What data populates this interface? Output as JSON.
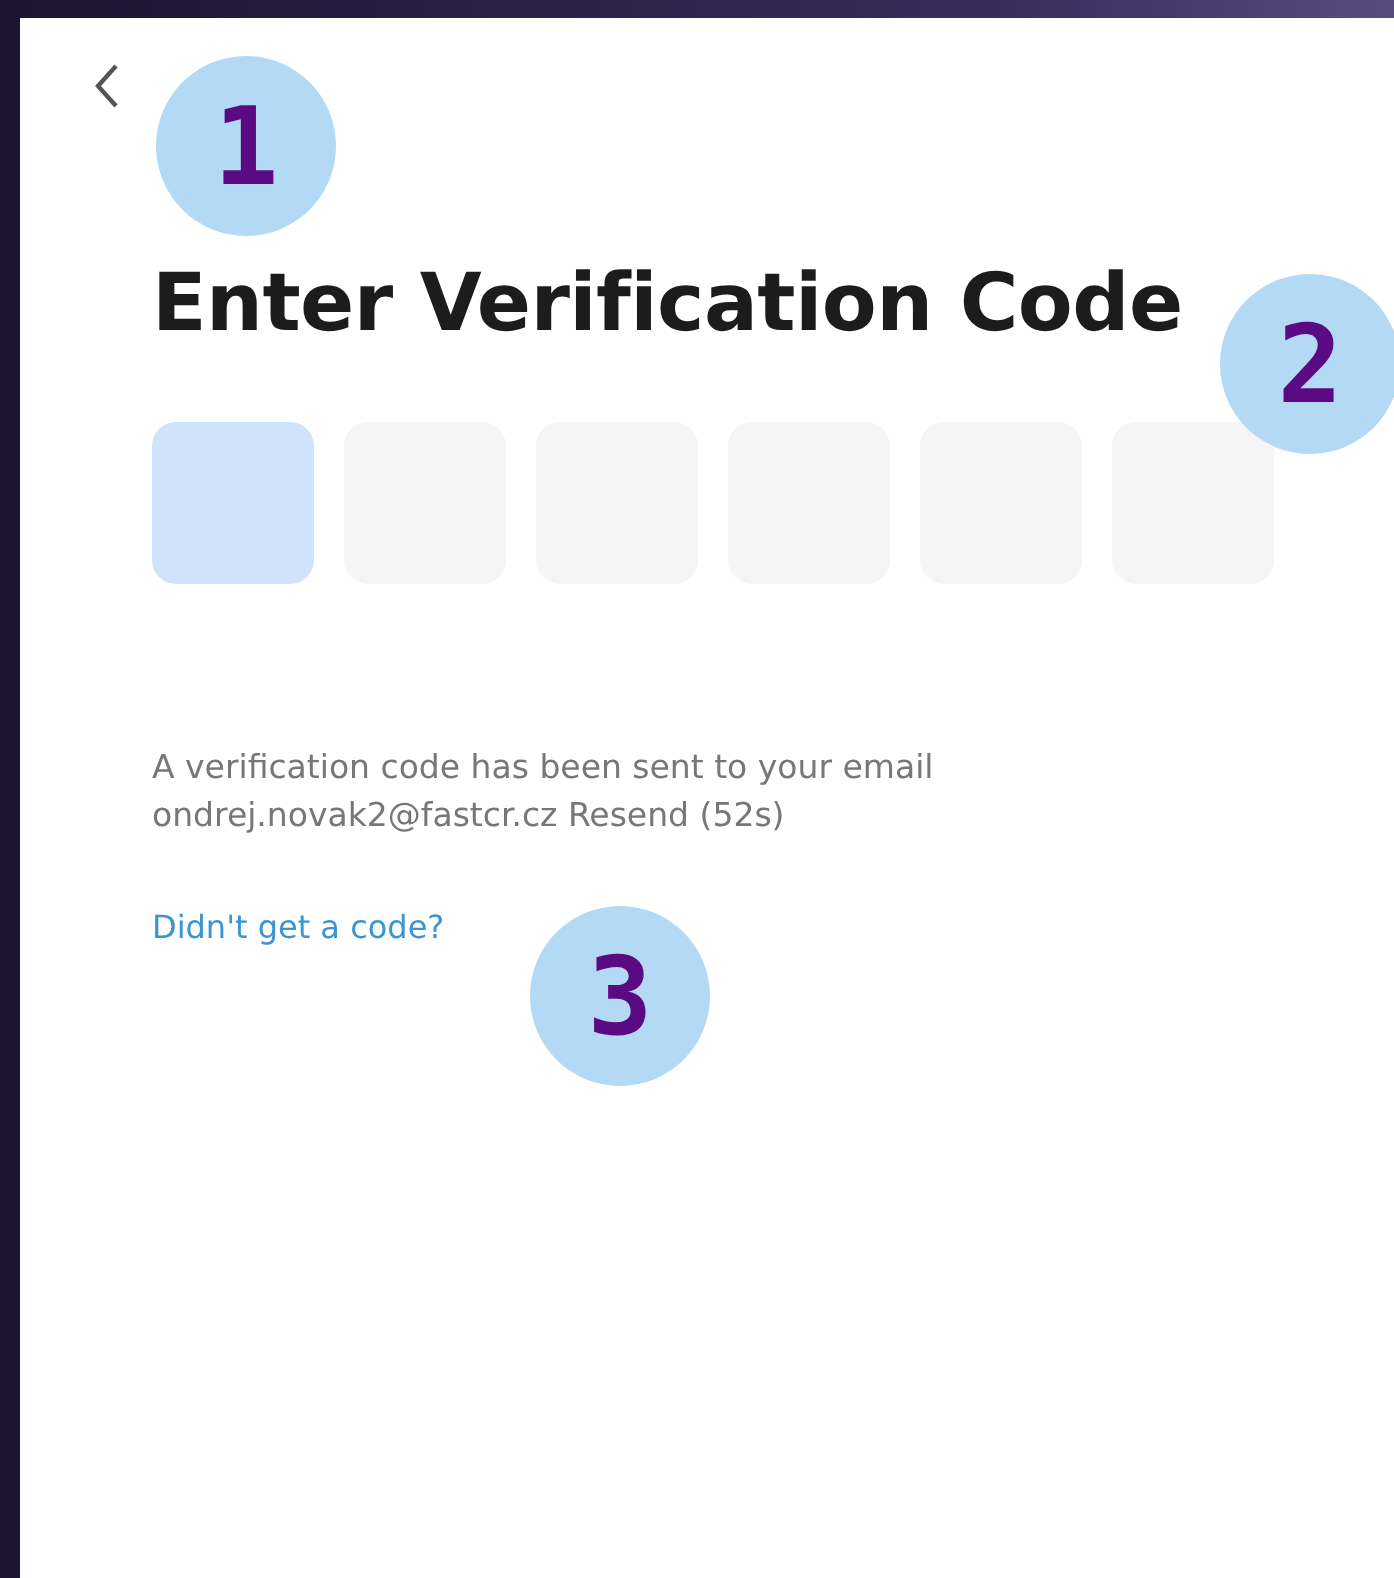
{
  "title": "Enter Verification Code",
  "code_boxes": [
    {
      "selected": true
    },
    {
      "selected": false
    },
    {
      "selected": false
    },
    {
      "selected": false
    },
    {
      "selected": false
    },
    {
      "selected": false
    }
  ],
  "message": {
    "line_1": "A verification code has been sent to your email",
    "line_2": "ondrej.novak2@fastcr.cz Resend (52s)"
  },
  "help_link": "Didn't get a code?",
  "callouts": [
    {
      "label": "1"
    },
    {
      "label": "2"
    },
    {
      "label": "3"
    }
  ]
}
